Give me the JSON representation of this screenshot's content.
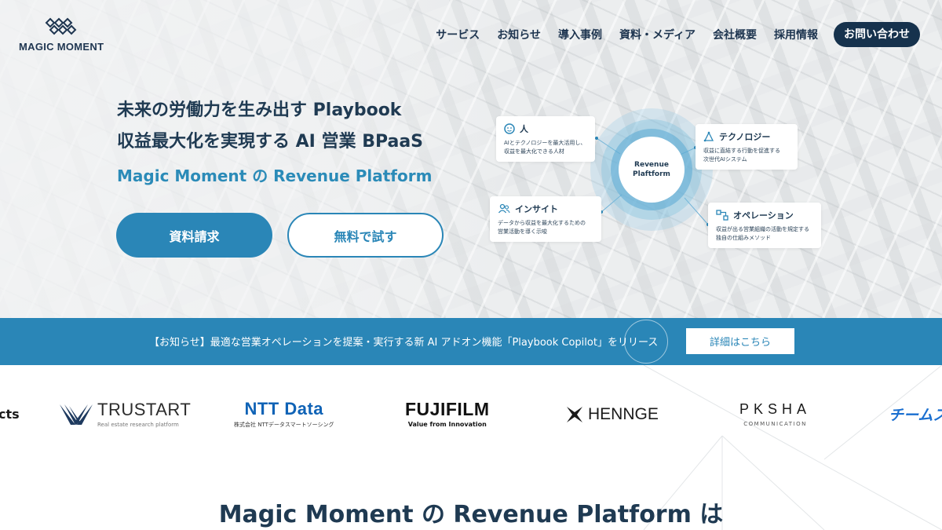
{
  "brand": {
    "name": "MAGIC MOMENT"
  },
  "nav": {
    "items": [
      "サービス",
      "お知らせ",
      "導入事例",
      "資料・メディア",
      "会社概要",
      "採用情報"
    ],
    "cta": "お問い合わせ"
  },
  "hero": {
    "tagline_1": "未来の労働力を生み出す Playbook",
    "tagline_2": "収益最大化を実現する AI 営業 BPaaS",
    "subheading": "Magic Moment の Revenue Platform",
    "primary_button": "資料請求",
    "secondary_button": "無料で試す"
  },
  "diagram": {
    "center_line1": "Revenue",
    "center_line2": "Plaftform",
    "cards": {
      "person": {
        "title": "人",
        "desc1": "AIとテクノロジーを最大活用し、",
        "desc2": "収益を最大化できる人材",
        "icon": "person-face-icon"
      },
      "tech": {
        "title": "テクノロジー",
        "desc1": "収益に直結する行動を促進する",
        "desc2": "次世代AIシステム",
        "icon": "tech-triangle-icon"
      },
      "insight": {
        "title": "インサイト",
        "desc1": "データから収益を最大化するための",
        "desc2": "営業活動を導く示唆",
        "icon": "users-icon"
      },
      "ops": {
        "title": "オペレーション",
        "desc1": "収益が出る営業組織の活動を規定する",
        "desc2": "独自の仕組みメソッド",
        "icon": "flow-icon"
      }
    }
  },
  "notice": {
    "text": "【お知らせ】最適な営業オペレーションを提案・実行する新 AI アドオン機能「Playbook Copilot」をリリース",
    "button": "詳細はこちら"
  },
  "logos": {
    "cut_left": "cts",
    "trustart": {
      "name": "TRUSTART",
      "sub": "Real estate research platform"
    },
    "ntt": {
      "name": "NTT Data",
      "sub": "株式会社 NTTデータスマートソーシング"
    },
    "fujifilm": {
      "name": "FUJIFILM",
      "sub": "Value from Innovation"
    },
    "hennge": {
      "name": "HENNGE"
    },
    "pksha": {
      "name": "PKSHA",
      "sub": "COMMUNICATION"
    },
    "team": {
      "name": "チームス"
    }
  },
  "section": {
    "heading": "Magic Moment の Revenue Platform は"
  },
  "colors": {
    "navy": "#16324d",
    "accent": "#2a86b7",
    "text": "#1f3a52"
  }
}
